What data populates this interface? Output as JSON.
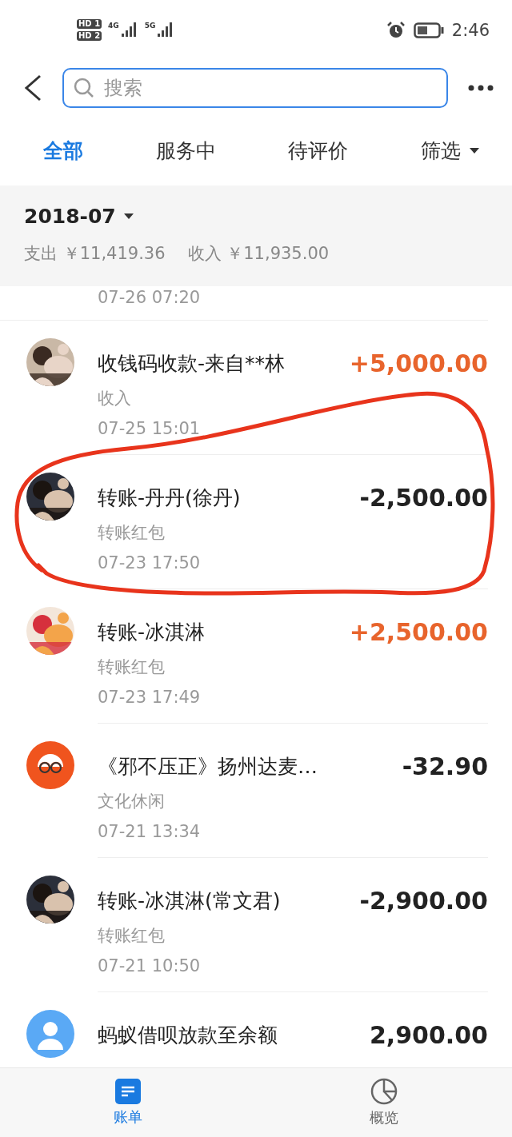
{
  "status_bar": {
    "time": "2:46",
    "sim_labels": [
      "HD 1",
      "HD 2"
    ],
    "networks": [
      "4G",
      "5G"
    ]
  },
  "search": {
    "placeholder": "搜索"
  },
  "tabs": [
    {
      "label": "全部",
      "selected": true,
      "kind": "tab"
    },
    {
      "label": "服务中",
      "selected": false,
      "kind": "tab"
    },
    {
      "label": "待评价",
      "selected": false,
      "kind": "tab"
    },
    {
      "label": "筛选",
      "selected": false,
      "kind": "filter"
    }
  ],
  "summary": {
    "month": "2018-07",
    "expense": "支出 ￥11,419.36",
    "income": "收入 ￥11,935.00"
  },
  "partial_top_date": "07-26  07:20",
  "bills": [
    {
      "title": "收钱码收款-来自**林",
      "category": "收入",
      "date": "07-25  15:01",
      "amount": "+5,000.00",
      "kind": "income",
      "circled": false
    },
    {
      "title": "转账-丹丹(徐丹)",
      "category": "转账红包",
      "date": "07-23  17:50",
      "amount": "-2,500.00",
      "kind": "expense",
      "circled": true
    },
    {
      "title": "转账-冰淇淋",
      "category": "转账红包",
      "date": "07-23  17:49",
      "amount": "+2,500.00",
      "kind": "income",
      "circled": false
    },
    {
      "title": "《邪不压正》扬州达麦…",
      "category": "文化休闲",
      "date": "07-21  13:34",
      "amount": "-32.90",
      "kind": "expense",
      "avatar": {
        "kind": "glasses"
      },
      "circled": false
    },
    {
      "title": "转账-冰淇淋(常文君)",
      "category": "转账红包",
      "date": "07-21  10:50",
      "amount": "-2,900.00",
      "kind": "expense",
      "circled": false
    },
    {
      "title": "蚂蚁借呗放款至余额",
      "amount": "2,900.00",
      "kind": "expense",
      "avatar": {
        "kind": "person"
      },
      "circled": false
    }
  ],
  "nav": [
    {
      "label": "账单",
      "selected": true,
      "kind": "bill"
    },
    {
      "label": "概览",
      "selected": false,
      "kind": "overview"
    }
  ]
}
